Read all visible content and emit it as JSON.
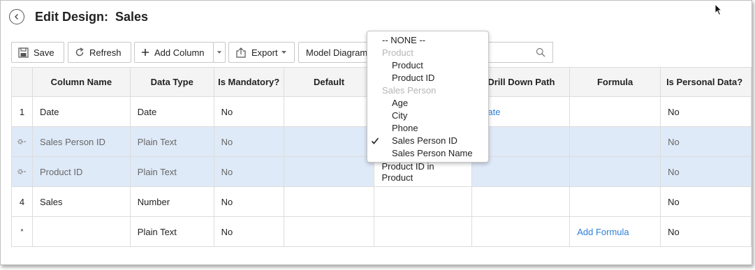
{
  "page": {
    "title": "Edit Design:  Sales"
  },
  "toolbar": {
    "save_label": "Save",
    "refresh_label": "Refresh",
    "add_column_label": "Add Column",
    "export_label": "Export",
    "model_diagram_label": "Model Diagram"
  },
  "table": {
    "headers": [
      "Column Name",
      "Data Type",
      "Is Mandatory?",
      "Default",
      "",
      "Drill Down Path",
      "Formula",
      "Is Personal Data?"
    ],
    "rows": [
      {
        "num": "1",
        "name": "Date",
        "type": "Date",
        "mandatory": "No",
        "lookup": "",
        "drill": "ate",
        "formula": "",
        "personal": "No"
      },
      {
        "num": "",
        "name": "Sales Person ID",
        "type": "Plain Text",
        "mandatory": "No",
        "lookup": "",
        "drill": "",
        "formula": "",
        "personal": "No"
      },
      {
        "num": "",
        "name": "Product ID",
        "type": "Plain Text",
        "mandatory": "No",
        "lookup": "Product ID in Product",
        "drill": "",
        "formula": "",
        "personal": "No"
      },
      {
        "num": "4",
        "name": "Sales",
        "type": "Number",
        "mandatory": "No",
        "lookup": "",
        "drill": "",
        "formula": "",
        "personal": "No"
      },
      {
        "num": "*",
        "name": "",
        "type": "Plain Text",
        "mandatory": "No",
        "lookup": "",
        "drill": "",
        "formula": "Add Formula",
        "personal": "No"
      }
    ]
  },
  "dropdown": {
    "none_label": "-- NONE --",
    "groups": [
      {
        "label": "Product",
        "items": [
          "Product",
          "Product ID"
        ]
      },
      {
        "label": "Sales Person",
        "items": [
          "Age",
          "City",
          "Phone",
          "Sales Person ID",
          "Sales Person Name"
        ]
      }
    ],
    "selected": "Sales Person ID"
  },
  "colors": {
    "selected_row": "#dfeaf8",
    "link": "#2d7fd8",
    "group_label": "#b5b5b5"
  },
  "icons": [
    "back-arrow-icon",
    "save-icon",
    "refresh-icon",
    "plus-icon",
    "chevron-down-icon",
    "export-icon",
    "search-icon",
    "gear-icon",
    "checkmark-icon",
    "mouse-cursor-icon"
  ]
}
